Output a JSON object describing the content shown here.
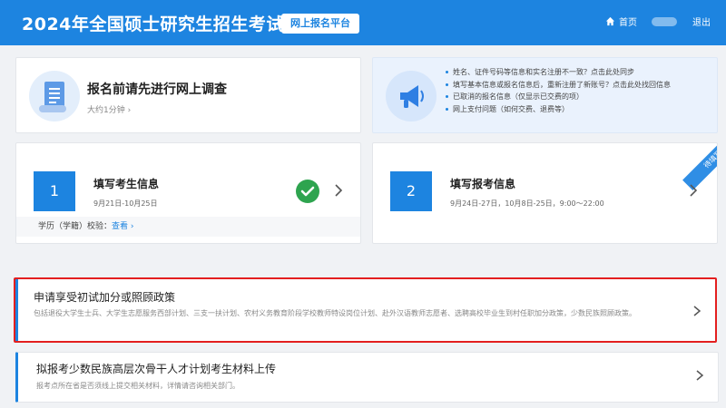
{
  "header": {
    "title": "2024年全国硕士研究生招生考试",
    "badge": "网上报名平台",
    "home_label": "首页",
    "logout_label": "退出",
    "accent_color": "#1d84e0"
  },
  "survey": {
    "title": "报名前请先进行网上调查",
    "subtitle": "大约1分钟 ›"
  },
  "notice": {
    "items": [
      "姓名、证件号码等信息和实名注册不一致？点击此处同步",
      "填写基本信息或报名信息后，重新注册了新账号？点击此处找回信息",
      "已取消的报名信息（仅显示已交费的项）",
      "网上支付问题（如何交费、退费等）"
    ]
  },
  "steps": [
    {
      "number": "1",
      "title": "填写考生信息",
      "date": "9月21日-10月25日",
      "status": "completed",
      "footer_label": "学历（学籍）校验：",
      "footer_link": "查看 ›"
    },
    {
      "number": "2",
      "title": "填写报考信息",
      "date": "9月24日-27日，10月8日-25日，9:00～22:00",
      "ribbon": "待填写"
    }
  ],
  "policies": [
    {
      "title": "申请享受初试加分或照顾政策",
      "description": "包括退役大学生士兵、大学生志愿服务西部计划、三支一扶计划、农村义务教育阶段学校教师特设岗位计划、赴外汉语教师志愿者、选聘高校毕业生到村任职加分政策，少数民族照顾政策。"
    },
    {
      "title": "拟报考少数民族高层次骨干人才计划考生材料上传",
      "description": "报考点所在省是否须线上提交相关材料，详情请咨询相关部门。"
    }
  ]
}
